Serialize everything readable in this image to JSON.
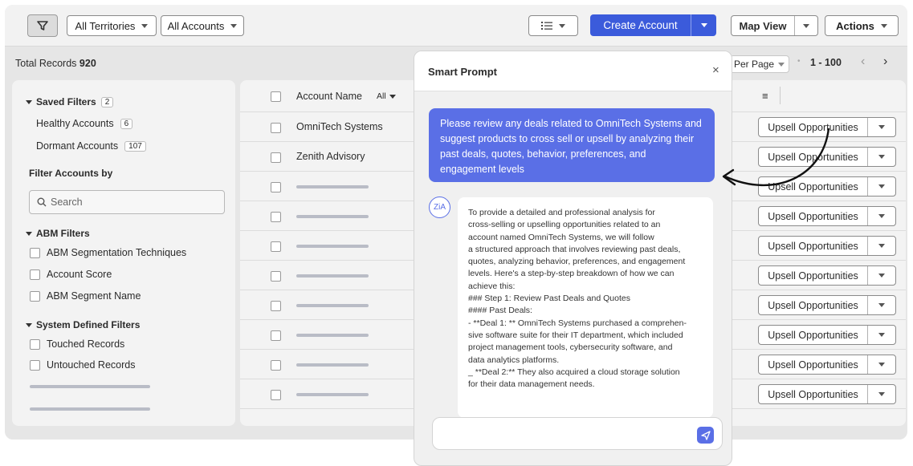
{
  "toolbar": {
    "territories_label": "All Territories",
    "accounts_label": "All Accounts",
    "create_account_label": "Create Account",
    "map_view_label": "Map View",
    "actions_label": "Actions"
  },
  "subbar": {
    "total_records_label": "Total Records",
    "total_records_value": "920",
    "per_page_label": "Per Page",
    "range_label": "1 - 100"
  },
  "sidebar": {
    "saved_filters_label": "Saved Filters",
    "saved_filters_count": "2",
    "saved_items": [
      {
        "label": "Healthy Accounts",
        "count": "6"
      },
      {
        "label": "Dormant Accounts",
        "count": "107"
      }
    ],
    "filter_by_label": "Filter Accounts by",
    "search_placeholder": "Search",
    "abm_filters_label": "ABM Filters",
    "abm_items": [
      "ABM Segmentation Techniques",
      "Account Score",
      "ABM Segment Name"
    ],
    "system_filters_label": "System Defined Filters",
    "system_items": [
      "Touched Records",
      "Untouched Records"
    ]
  },
  "table": {
    "column_header": "Account Name",
    "column_filter": "All",
    "rows": [
      "OmniTech Systems",
      "Zenith Advisory"
    ],
    "row_action_label": "Upsell Opportunities"
  },
  "modal": {
    "title": "Smart Prompt",
    "close_label": "×",
    "user_message_lines": [
      "Please review any deals related to OmniTech Systems and",
      "suggest products to cross sell or upsell by analyzing their",
      "past deals, quotes, behavior, preferences, and",
      "engagement levels"
    ],
    "ai_avatar_label": "ZiA",
    "ai_response_lines": [
      "To provide a detailed and professional analysis for",
      "cross-selling or upselling opportunities related to an",
      "account named OmniTech Systems, we will follow",
      "a structured approach that involves reviewing past deals,",
      "quotes, analyzing behavior, preferences, and engagement",
      "levels. Here's a step-by-step breakdown of how we can",
      "achieve this:",
      "### Step 1: Review Past Deals and Quotes",
      "#### Past Deals:",
      "- **Deal 1: ** OmniTech Systems purchased a comprehen-",
      "sive software suite for their IT department, which included",
      "project management tools, cybersecurity software, and",
      "data analytics platforms.",
      "_ **Deal 2:** They also acquired a cloud storage solution",
      "for their data management needs."
    ]
  },
  "colors": {
    "accent": "#5a6fe6",
    "primary_button": "#3b5bdb"
  }
}
